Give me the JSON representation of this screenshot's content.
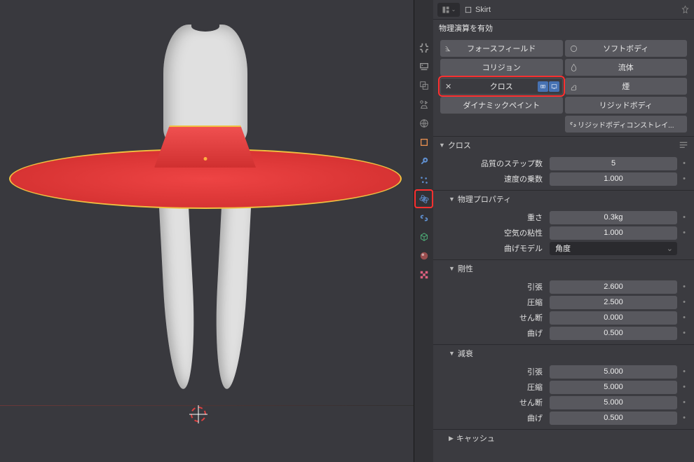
{
  "header": {
    "editor_type": "properties-editor",
    "object_name": "Skirt",
    "object_icon": "mesh-icon"
  },
  "physics_enable_label": "物理演算を有効",
  "physics_buttons": {
    "forcefield": "フォースフィールド",
    "softbody": "ソフトボディ",
    "collision": "コリジョン",
    "fluid": "流体",
    "cloth": "クロス",
    "smoke": "煙",
    "dynamicpaint": "ダイナミックペイント",
    "rigidbody": "リジッドボディ",
    "rigidbody_constraint": "リジッドボディコンストレイ..."
  },
  "sections": {
    "cloth": "クロス",
    "physprops": "物理プロパティ",
    "stiffness": "剛性",
    "damping": "減衰",
    "cache": "キャッシュ"
  },
  "props": {
    "quality_steps": {
      "label": "品質のステップ数",
      "value": "5"
    },
    "speed_mult": {
      "label": "速度の乗数",
      "value": "1.000"
    },
    "mass": {
      "label": "重さ",
      "value": "0.3kg"
    },
    "air_visc": {
      "label": "空気の粘性",
      "value": "1.000"
    },
    "bend_model": {
      "label": "曲げモデル",
      "value": "角度"
    },
    "stiffness": {
      "tension": {
        "label": "引張",
        "value": "2.600"
      },
      "compression": {
        "label": "圧縮",
        "value": "2.500"
      },
      "shear": {
        "label": "せん断",
        "value": "0.000"
      },
      "bending": {
        "label": "曲げ",
        "value": "0.500"
      }
    },
    "damping": {
      "tension": {
        "label": "引張",
        "value": "5.000"
      },
      "compression": {
        "label": "圧縮",
        "value": "5.000"
      },
      "shear": {
        "label": "せん断",
        "value": "5.000"
      },
      "bending": {
        "label": "曲げ",
        "value": "0.500"
      }
    }
  },
  "tabs": [
    "render",
    "output",
    "view-layer",
    "scene",
    "world",
    "object",
    "modifier",
    "particle",
    "physics",
    "constraint",
    "mesh-data",
    "material",
    "texture"
  ]
}
